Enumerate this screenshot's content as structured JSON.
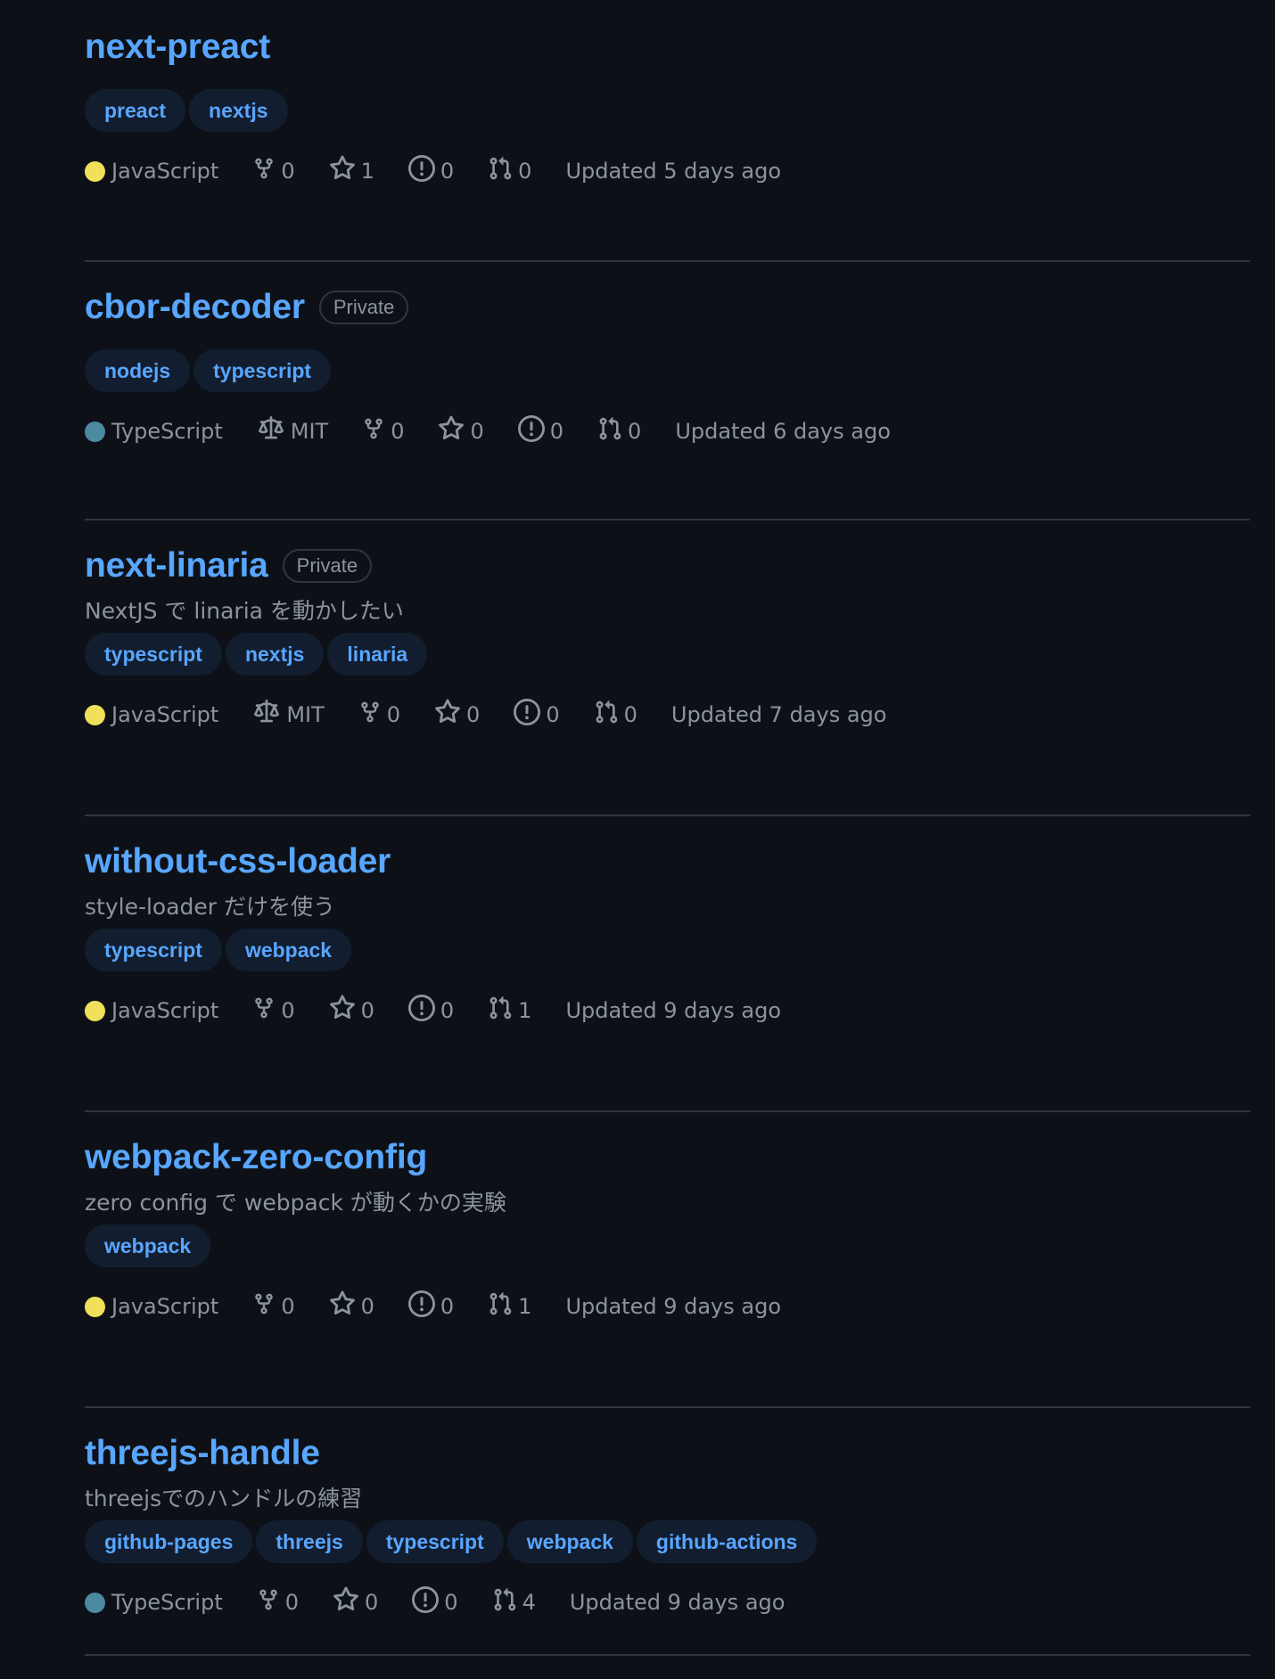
{
  "colors": {
    "link": "#58a6ff",
    "muted": "#8b949e",
    "spark": "#56d364",
    "javascript": "#f1e05a",
    "typescript": "#3178c6"
  },
  "repos": [
    {
      "name": "next-preact",
      "visibility": "",
      "description": "",
      "topics": [
        "preact",
        "nextjs"
      ],
      "language": "JavaScript",
      "lang_color": "#f1e05a",
      "license": "",
      "forks": "0",
      "stars": "1",
      "issues": "0",
      "prs": "0",
      "updated": "Updated 5 days ago",
      "activity": "end-uptick"
    },
    {
      "name": "cbor-decoder",
      "visibility": "Private",
      "description": "",
      "topics": [
        "nodejs",
        "typescript"
      ],
      "language": "TypeScript",
      "lang_color": "#3178c6",
      "license": "MIT",
      "forks": "0",
      "stars": "0",
      "issues": "0",
      "prs": "0",
      "updated": "Updated 6 days ago",
      "activity": "end-spike"
    },
    {
      "name": "next-linaria",
      "visibility": "Private",
      "description": "NextJS で linaria を動かしたい",
      "topics": [
        "typescript",
        "nextjs",
        "linaria"
      ],
      "language": "JavaScript",
      "lang_color": "#f1e05a",
      "license": "MIT",
      "forks": "0",
      "stars": "0",
      "issues": "0",
      "prs": "0",
      "updated": "Updated 7 days ago",
      "activity": "end-uptick"
    },
    {
      "name": "without-css-loader",
      "visibility": "",
      "description": "style-loader だけを使う",
      "topics": [
        "typescript",
        "webpack"
      ],
      "language": "JavaScript",
      "lang_color": "#f1e05a",
      "license": "",
      "forks": "0",
      "stars": "0",
      "issues": "0",
      "prs": "1",
      "updated": "Updated 9 days ago",
      "activity": "mid-bump"
    },
    {
      "name": "webpack-zero-config",
      "visibility": "",
      "description": "zero config で webpack が動くかの実験",
      "topics": [
        "webpack"
      ],
      "language": "JavaScript",
      "lang_color": "#f1e05a",
      "license": "",
      "forks": "0",
      "stars": "0",
      "issues": "0",
      "prs": "1",
      "updated": "Updated 9 days ago",
      "activity": "mid-small-bump"
    },
    {
      "name": "threejs-handle",
      "visibility": "",
      "description": "threejsでのハンドルの練習",
      "topics": [
        "github-pages",
        "threejs",
        "typescript",
        "webpack",
        "github-actions"
      ],
      "language": "TypeScript",
      "lang_color": "#3178c6",
      "license": "",
      "forks": "0",
      "stars": "0",
      "issues": "0",
      "prs": "4",
      "updated": "Updated 9 days ago",
      "activity": "mid-bump"
    }
  ]
}
